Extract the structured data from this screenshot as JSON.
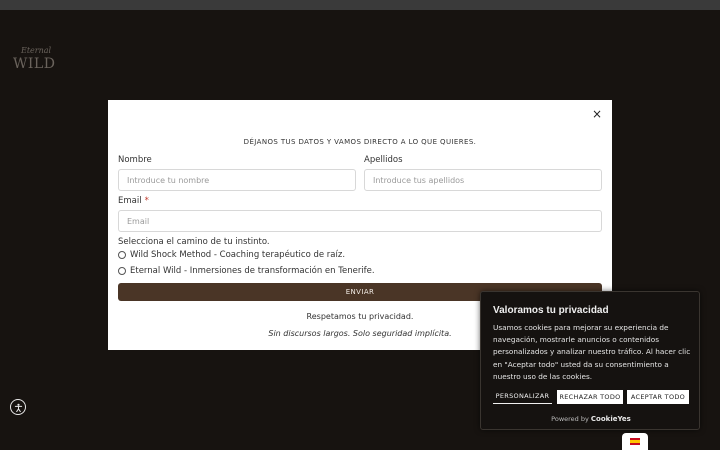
{
  "logo": {
    "script": "Eternal",
    "word": "WILD"
  },
  "modal": {
    "close_glyph": "×",
    "heading": "DÉJANOS TUS DATOS Y VAMOS DIRECTO A LO QUE QUIERES.",
    "fields": {
      "nombre_label": "Nombre",
      "nombre_placeholder": "Introduce tu nombre",
      "apellidos_label": "Apellidos",
      "apellidos_placeholder": "Introduce tus apellidos",
      "email_label": "Email",
      "email_required": "*",
      "email_placeholder": "Email"
    },
    "choice_label": "Selecciona el camino de tu instinto.",
    "options": [
      "Wild Shock Method - Coaching terapéutico de raíz.",
      "Eternal Wild - Inmersiones de transformación en Tenerife."
    ],
    "submit": "ENVIAR",
    "privacy": "Respetamos tu privacidad.",
    "tagline": "Sin discursos largos. Solo seguridad implícita."
  },
  "cookie_banner": {
    "title": "Valoramos tu privacidad",
    "text": "Usamos cookies para mejorar su experiencia de navegación, mostrarle anuncios o contenidos personalizados y analizar nuestro tráfico. Al hacer clic en \"Aceptar todo\" usted da su consentimiento a nuestro uso de las cookies.",
    "customize": "PERSONALIZAR",
    "reject": "RECHAZAR TODO",
    "accept": "ACEPTAR TODO",
    "powered_by": "Powered by",
    "powered_brand": "CookieYes"
  },
  "icons": {
    "accessibility": "accessibility-icon",
    "language_flag": "spain-flag-icon",
    "close": "close-icon"
  },
  "colors": {
    "background": "#171310",
    "submit_button": "#4a3526",
    "required": "#c0392b"
  }
}
